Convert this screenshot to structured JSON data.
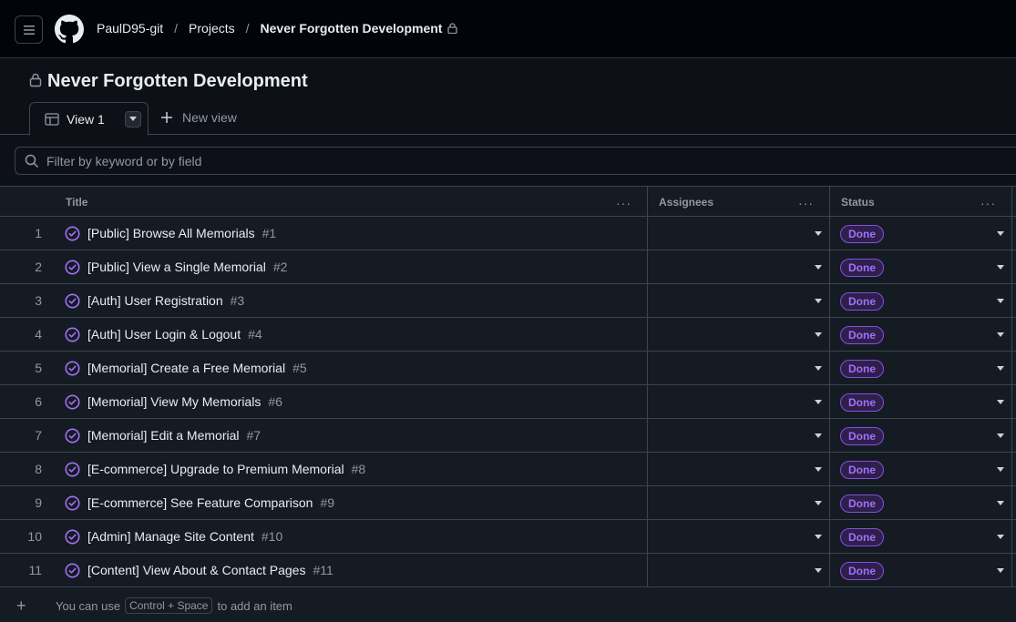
{
  "header": {
    "breadcrumbs": [
      "PaulD95-git",
      "Projects",
      "Never Forgotten Development"
    ],
    "separator": "/"
  },
  "project": {
    "title": "Never Forgotten Development"
  },
  "tabs": {
    "active_label": "View 1",
    "new_label": "New view"
  },
  "filter": {
    "placeholder": "Filter by keyword or by field"
  },
  "table": {
    "columns": [
      "Title",
      "Assignees",
      "Status"
    ],
    "rows": [
      {
        "num": "1",
        "title": "[Public] Browse All Memorials",
        "ref": "#1",
        "status": "Done"
      },
      {
        "num": "2",
        "title": "[Public] View a Single Memorial",
        "ref": "#2",
        "status": "Done"
      },
      {
        "num": "3",
        "title": "[Auth] User Registration",
        "ref": "#3",
        "status": "Done"
      },
      {
        "num": "4",
        "title": "[Auth] User Login & Logout",
        "ref": "#4",
        "status": "Done"
      },
      {
        "num": "5",
        "title": "[Memorial] Create a Free Memorial",
        "ref": "#5",
        "status": "Done"
      },
      {
        "num": "6",
        "title": "[Memorial] View My Memorials",
        "ref": "#6",
        "status": "Done"
      },
      {
        "num": "7",
        "title": "[Memorial] Edit a Memorial",
        "ref": "#7",
        "status": "Done"
      },
      {
        "num": "8",
        "title": "[E-commerce] Upgrade to Premium Memorial",
        "ref": "#8",
        "status": "Done"
      },
      {
        "num": "9",
        "title": "[E-commerce] See Feature Comparison",
        "ref": "#9",
        "status": "Done"
      },
      {
        "num": "10",
        "title": "[Admin] Manage Site Content",
        "ref": "#10",
        "status": "Done"
      },
      {
        "num": "11",
        "title": "[Content] View About & Contact Pages",
        "ref": "#11",
        "status": "Done"
      }
    ]
  },
  "footer": {
    "prefix": "You can use",
    "shortcut": "Control + Space",
    "suffix": "to add an item"
  },
  "colors": {
    "accent_done": "#a371f7",
    "background": "#0d1117",
    "header_bg": "#010409"
  }
}
